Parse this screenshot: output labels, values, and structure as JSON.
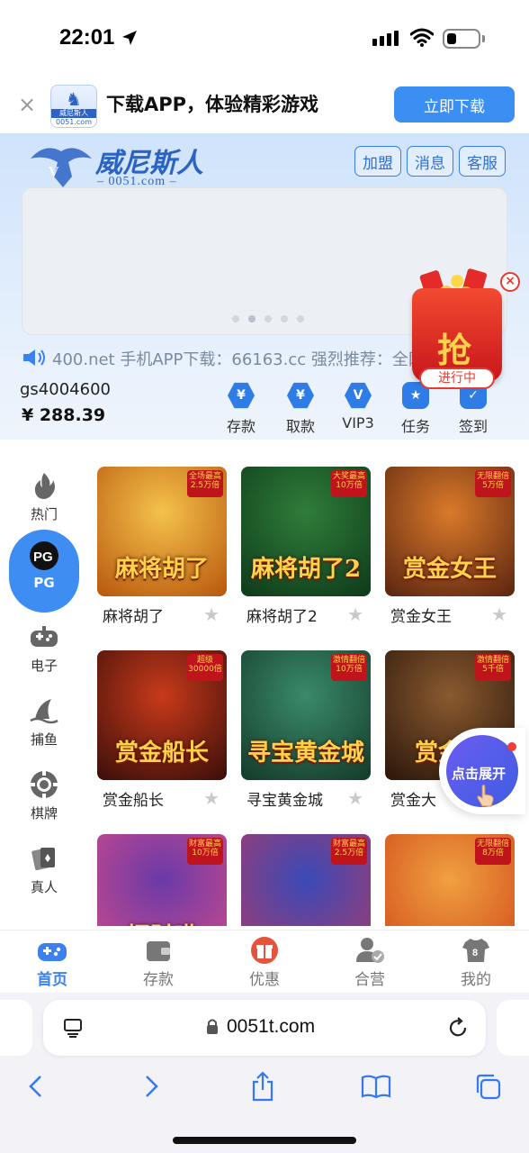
{
  "status_bar": {
    "time": "22:01"
  },
  "app_banner": {
    "close": "×",
    "logo_top": "威尼斯人",
    "logo_bottom": "0051.com",
    "text": "下载APP，体验精彩游戏",
    "button": "立即下载"
  },
  "brand": {
    "name": "威尼斯人",
    "url": "– 0051.com –"
  },
  "header_buttons": [
    "加盟",
    "消息",
    "客服"
  ],
  "notice": {
    "text": "400.net 手机APP下载：66163.cc 强烈推荐：全网"
  },
  "user": {
    "username": "gs4004600",
    "balance": "¥ 288.39"
  },
  "quick_actions": [
    {
      "label": "存款",
      "icon": "deposit-icon",
      "glyph": "¥"
    },
    {
      "label": "取款",
      "icon": "withdraw-icon",
      "glyph": "¥"
    },
    {
      "label": "VIP3",
      "icon": "vip-icon",
      "glyph": "V"
    },
    {
      "label": "任务",
      "icon": "task-icon",
      "glyph": "★"
    },
    {
      "label": "签到",
      "icon": "checkin-icon",
      "glyph": "✓"
    }
  ],
  "envelope": {
    "char": "抢",
    "tag": "进行中",
    "close": "×"
  },
  "sidebar": [
    {
      "label": "热门",
      "icon": "flame-icon"
    },
    {
      "label": "PG",
      "icon": "pg-logo-icon",
      "active": true
    },
    {
      "label": "电子",
      "icon": "gamepad-icon"
    },
    {
      "label": "捕鱼",
      "icon": "shark-fin-icon"
    },
    {
      "label": "棋牌",
      "icon": "poker-chip-icon"
    },
    {
      "label": "真人",
      "icon": "cards-icon"
    }
  ],
  "games": [
    {
      "name": "麻将胡了",
      "thumb_title": "麻将胡了",
      "tag": "全场最高2.5万倍",
      "bg": [
        "#f4c24a",
        "#b8570e"
      ]
    },
    {
      "name": "麻将胡了2",
      "thumb_title": "麻将胡了2",
      "tag": "大奖最高10万倍",
      "bg": [
        "#2f7d3a",
        "#0e3a1a"
      ]
    },
    {
      "name": "赏金女王",
      "thumb_title": "赏金女王",
      "tag": "无限翻倍5万倍",
      "bg": [
        "#d97a2a",
        "#5a2410"
      ]
    },
    {
      "name": "赏金船长",
      "thumb_title": "赏金船长",
      "tag": "超级30000倍",
      "bg": [
        "#c83a1a",
        "#3a0e0a"
      ]
    },
    {
      "name": "寻宝黄金城",
      "thumb_title": "寻宝黄金城",
      "tag": "激情翻倍10万倍",
      "bg": [
        "#3a8a6a",
        "#143a2a"
      ]
    },
    {
      "name": "赏金大",
      "thumb_title": "赏金大",
      "tag": "激情翻倍5千倍",
      "bg": [
        "#8a5a30",
        "#2a160a"
      ]
    },
    {
      "name": "",
      "thumb_title": "招财喵",
      "tag": "财富最高10万倍",
      "bg": [
        "#6a3aa8",
        "#d04a8a"
      ]
    },
    {
      "name": "",
      "thumb_title": "",
      "tag": "财富最高2.5万倍",
      "bg": [
        "#3a4ab8",
        "#a83a6a"
      ]
    },
    {
      "name": "",
      "thumb_title": "",
      "tag": "无限翻倍8万倍",
      "bg": [
        "#f0a040",
        "#d04a1a"
      ]
    }
  ],
  "expand_bubble": {
    "text": "点击展开"
  },
  "tabbar": [
    {
      "label": "首页",
      "icon": "gamepad-icon",
      "active": true
    },
    {
      "label": "存款",
      "icon": "wallet-icon"
    },
    {
      "label": "优惠",
      "icon": "gift-icon"
    },
    {
      "label": "合营",
      "icon": "partner-icon"
    },
    {
      "label": "我的",
      "icon": "jersey-icon"
    }
  ],
  "safari": {
    "url": "0051t.com"
  },
  "colors": {
    "accent": "#3b8ff2",
    "header_bg": "#cfe3fb",
    "red": "#e53b30"
  }
}
